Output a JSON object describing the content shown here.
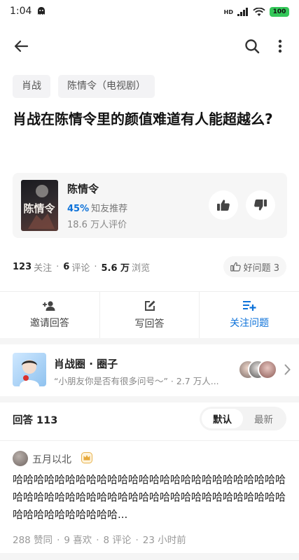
{
  "status_bar": {
    "time": "1:04",
    "network": "HD",
    "battery": "100"
  },
  "topbar": {
    "back": "back-arrow-icon",
    "search": "search-icon",
    "more": "more-vertical-icon"
  },
  "topics": [
    "肖战",
    "陈情令（电视剧）"
  ],
  "question": {
    "title": "肖战在陈情令里的颜值难道有人能超越么?"
  },
  "media": {
    "poster_text": "陈情令",
    "name": "陈情令",
    "recommend_pct": "45%",
    "recommend_label": "知友推荐",
    "rating_count": "18.6 万人评价"
  },
  "stats": {
    "follow_count": "123",
    "follow_label": "关注",
    "comment_count": "6",
    "comment_label": "评论",
    "view_count": "5.6 万",
    "view_label": "浏览",
    "good_question": "好问题 3"
  },
  "actions": [
    {
      "label": "邀请回答",
      "icon": "invite-user-icon"
    },
    {
      "label": "写回答",
      "icon": "edit-icon"
    },
    {
      "label": "关注问题",
      "icon": "follow-list-icon"
    }
  ],
  "circle": {
    "name": "肖战圈 · 圈子",
    "desc": "“小朋友你是否有很多问号～” · 2.7 万人..."
  },
  "answers": {
    "count_label": "回答 113",
    "sort_default": "默认",
    "sort_latest": "最新"
  },
  "answer": {
    "author": "五月以北",
    "body": "哈哈哈哈哈哈哈哈哈哈哈哈哈哈哈哈哈哈哈哈哈哈哈哈哈哈哈哈哈哈哈哈哈哈哈哈哈哈哈哈哈哈哈哈哈哈哈哈哈哈哈哈哈哈哈哈哈哈哈哈哈哈...",
    "likes": "288 赞同",
    "favorites": "9 喜欢",
    "comments": "8 评论",
    "time": "23 小时前"
  },
  "colors": {
    "accent": "#0d72d9",
    "battery": "#34c759",
    "chip_bg": "#f3f3f5"
  }
}
